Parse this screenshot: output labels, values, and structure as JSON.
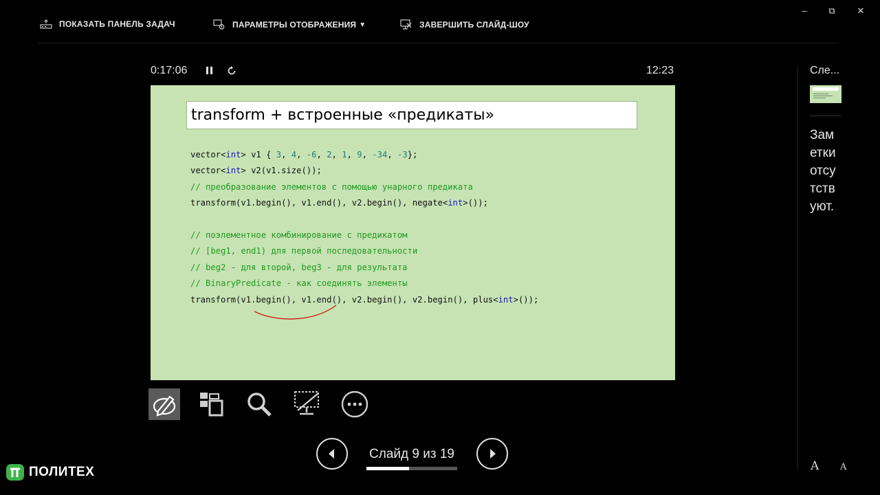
{
  "toolbar": {
    "show_taskbar": "ПОКАЗАТЬ ПАНЕЛЬ ЗАДАЧ",
    "display_settings": "ПАРАМЕТРЫ ОТОБРАЖЕНИЯ",
    "end_show": "ЗАВЕРШИТЬ СЛАЙД-ШОУ"
  },
  "window_controls": {
    "minimize": "–",
    "restore": "⧉",
    "close": "✕"
  },
  "presenter": {
    "elapsed": "0:17:06",
    "clock": "12:23"
  },
  "slide": {
    "title": "transform + встроенные «предикаты»",
    "code_lines": [
      "vector<int> v1 { 3, 4, -6, 2, 1, 9, -34, -3};",
      "vector<int> v2(v1.size());",
      "// преобразование элементов с помощью унарного предиката",
      "transform(v1.begin(), v1.end(), v2.begin(), negate<int>());",
      "",
      "// поэлементное комбинирование с предикатом",
      "// [beg1, end1) для первой последовательности",
      "// beg2 - для второй, beg3 - для результата",
      "// BinaryPredicate - как соединять элементы",
      "transform(v1.begin(), v1.end(), v2.begin(), v2.begin(), plus<int>());"
    ]
  },
  "navigation": {
    "slide_label": "Слайд 9 из 19",
    "current": 9,
    "total": 19,
    "progress": 0.47
  },
  "side_panel": {
    "next_label": "Сле...",
    "notes": "Заметки отсутствуют.",
    "font_increase": "A",
    "font_decrease": "A"
  },
  "logo": {
    "text": "ПОЛИТЕХ"
  },
  "colors": {
    "slide_bg": "#c7e3b4",
    "keyword": "#1a1ab8",
    "number": "#1f7f77",
    "comment": "#1e9a1e",
    "ink": "#d0201a"
  },
  "icons": [
    "taskbar-icon",
    "display-settings-icon",
    "end-show-icon",
    "pause-icon",
    "restart-icon",
    "pen-tool-icon",
    "all-slides-icon",
    "zoom-icon",
    "black-screen-icon",
    "more-options-icon",
    "previous-arrow-icon",
    "next-arrow-icon"
  ]
}
